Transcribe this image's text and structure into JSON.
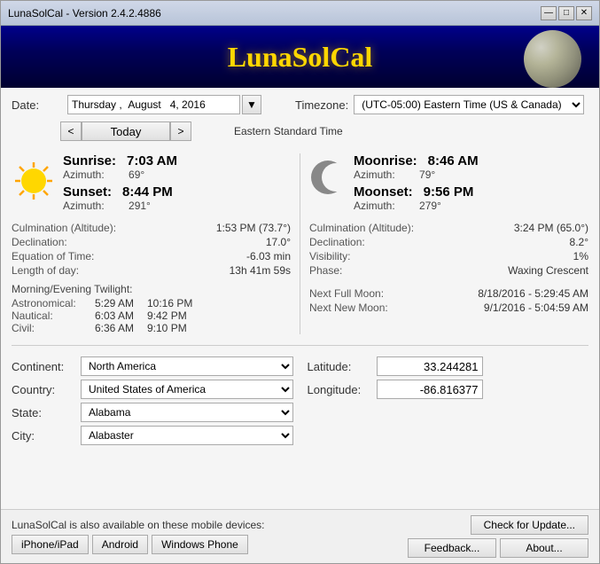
{
  "window": {
    "title": "LunaSolCal - Version 2.4.2.4886",
    "header_title": "LunaSolCal"
  },
  "date": {
    "label": "Date:",
    "value": "Thursday ,  August   4, 2016",
    "display_day": "Thursday",
    "display_month": "August",
    "display_num": "4,",
    "display_year": "2016",
    "prev_label": "<",
    "today_label": "Today",
    "next_label": ">"
  },
  "timezone": {
    "label": "Timezone:",
    "value": "(UTC-05:00) Eastern Time (US & Canada)",
    "standard": "Eastern Standard Time"
  },
  "sun": {
    "sunrise_label": "Sunrise:",
    "sunrise_value": "7:03 AM",
    "sunrise_azimuth_label": "Azimuth:",
    "sunrise_azimuth_value": "69°",
    "sunset_label": "Sunset:",
    "sunset_value": "8:44 PM",
    "sunset_azimuth_label": "Azimuth:",
    "sunset_azimuth_value": "291°",
    "culmination_label": "Culmination (Altitude):",
    "culmination_value": "1:53 PM (73.7°)",
    "declination_label": "Declination:",
    "declination_value": "17.0°",
    "equation_label": "Equation of Time:",
    "equation_value": "-6.03 min",
    "length_label": "Length of day:",
    "length_value": "13h 41m 59s"
  },
  "twilight": {
    "title": "Morning/Evening Twilight:",
    "astronomical_label": "Astronomical:",
    "astronomical_morning": "5:29 AM",
    "astronomical_evening": "10:16 PM",
    "nautical_label": "Nautical:",
    "nautical_morning": "6:03 AM",
    "nautical_evening": "9:42 PM",
    "civil_label": "Civil:",
    "civil_morning": "6:36 AM",
    "civil_evening": "9:10 PM"
  },
  "moon": {
    "moonrise_label": "Moonrise:",
    "moonrise_value": "8:46 AM",
    "moonrise_azimuth_label": "Azimuth:",
    "moonrise_azimuth_value": "79°",
    "moonset_label": "Moonset:",
    "moonset_value": "9:56 PM",
    "moonset_azimuth_label": "Azimuth:",
    "moonset_azimuth_value": "279°",
    "culmination_label": "Culmination (Altitude):",
    "culmination_value": "3:24 PM (65.0°)",
    "declination_label": "Declination:",
    "declination_value": "8.2°",
    "visibility_label": "Visibility:",
    "visibility_value": "1%",
    "phase_label": "Phase:",
    "phase_value": "Waxing Crescent",
    "next_full_label": "Next Full Moon:",
    "next_full_value": "8/18/2016 - 5:29:45 AM",
    "next_new_label": "Next New Moon:",
    "next_new_value": "9/1/2016 - 5:04:59 AM"
  },
  "location": {
    "continent_label": "Continent:",
    "continent_value": "North America",
    "country_label": "Country:",
    "country_value": "United States of America",
    "state_label": "State:",
    "state_value": "Alabama",
    "city_label": "City:",
    "city_value": "Alabaster",
    "latitude_label": "Latitude:",
    "latitude_value": "33.244281",
    "longitude_label": "Longitude:",
    "longitude_value": "-86.816377"
  },
  "footer": {
    "mobile_text": "LunaSolCal is also available on these mobile devices:",
    "iphone_label": "iPhone/iPad",
    "android_label": "Android",
    "windows_phone_label": "Windows Phone",
    "check_update_label": "Check for Update...",
    "feedback_label": "Feedback...",
    "about_label": "About..."
  },
  "title_bar_buttons": {
    "minimize": "—",
    "maximize": "□",
    "close": "✕"
  }
}
